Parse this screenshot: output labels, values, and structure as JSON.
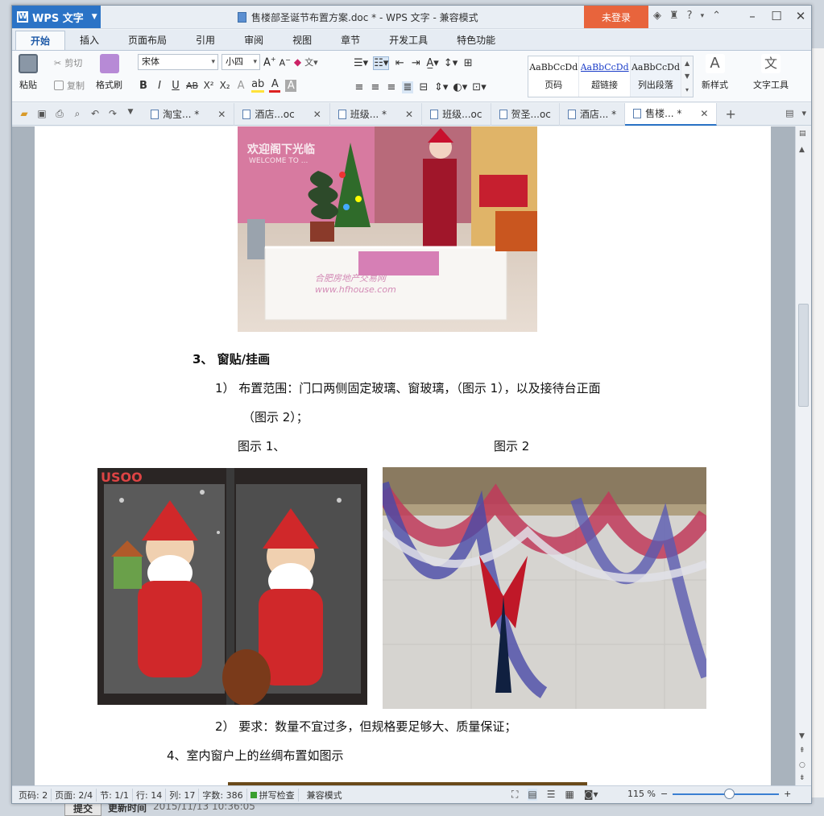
{
  "window": {
    "app_button": "WPS 文字",
    "title": "售楼部圣诞节布置方案.doc * - WPS 文字 - 兼容模式",
    "login": "未登录"
  },
  "menu_tabs": [
    {
      "label": "开始",
      "active": true
    },
    {
      "label": "插入",
      "active": false
    },
    {
      "label": "页面布局",
      "active": false
    },
    {
      "label": "引用",
      "active": false
    },
    {
      "label": "审阅",
      "active": false
    },
    {
      "label": "视图",
      "active": false
    },
    {
      "label": "章节",
      "active": false
    },
    {
      "label": "开发工具",
      "active": false
    },
    {
      "label": "特色功能",
      "active": false
    }
  ],
  "ribbon": {
    "paste": "粘贴",
    "cut": "剪切",
    "copy": "复制",
    "format_painter": "格式刷",
    "font_name": "宋体",
    "font_size": "小四",
    "styles": [
      {
        "sample": "AaBbCcDd",
        "name": "页码"
      },
      {
        "sample": "AaBbCcDd",
        "name": "超链接"
      },
      {
        "sample": "AaBbCcDd",
        "name": "列出段落"
      }
    ],
    "new_style": "新样式",
    "text_tools": "文字工具"
  },
  "doc_tabs": [
    {
      "label": "淘宝... *",
      "active": false
    },
    {
      "label": "酒店...oc",
      "active": false
    },
    {
      "label": "班级... *",
      "active": false
    },
    {
      "label": "班级...oc",
      "active": false
    },
    {
      "label": "贺圣...oc",
      "active": false
    },
    {
      "label": "酒店... *",
      "active": false
    },
    {
      "label": "售楼... *",
      "active": true
    }
  ],
  "document": {
    "heading3": "3、  窗贴/挂画",
    "item1_line1": "1）  布置范围：门口两侧固定玻璃、窗玻璃，（图示 1），以及接待台正面",
    "item1_line2": "（图示 2）；",
    "caption1": "图示 1、",
    "caption2": "图示 2",
    "item2": "2）  要求：数量不宜过多，但规格要足够大、质量保证；",
    "heading4": "4、室内窗户上的丝绸布置如图示",
    "image1_text": "欢迎阁下光临",
    "image1_sub": "WELCOME TO ...",
    "image1_watermark": "合肥房地产交易网 www.hfhouse.com",
    "image2_text": "USOO"
  },
  "status": {
    "page_no": "页码: 2",
    "pages": "页面: 2/4",
    "section": "节: 1/1",
    "row": "行: 14",
    "col": "列: 17",
    "words": "字数: 386",
    "spell": "拼写检查",
    "mode": "兼容模式",
    "zoom": "115 %"
  },
  "background": {
    "submit": "提交",
    "update_time_label": "更新时间",
    "update_time": "2015/11/13 10:36:05"
  },
  "colors": {
    "accent": "#2b73c6",
    "login": "#e8643c"
  }
}
